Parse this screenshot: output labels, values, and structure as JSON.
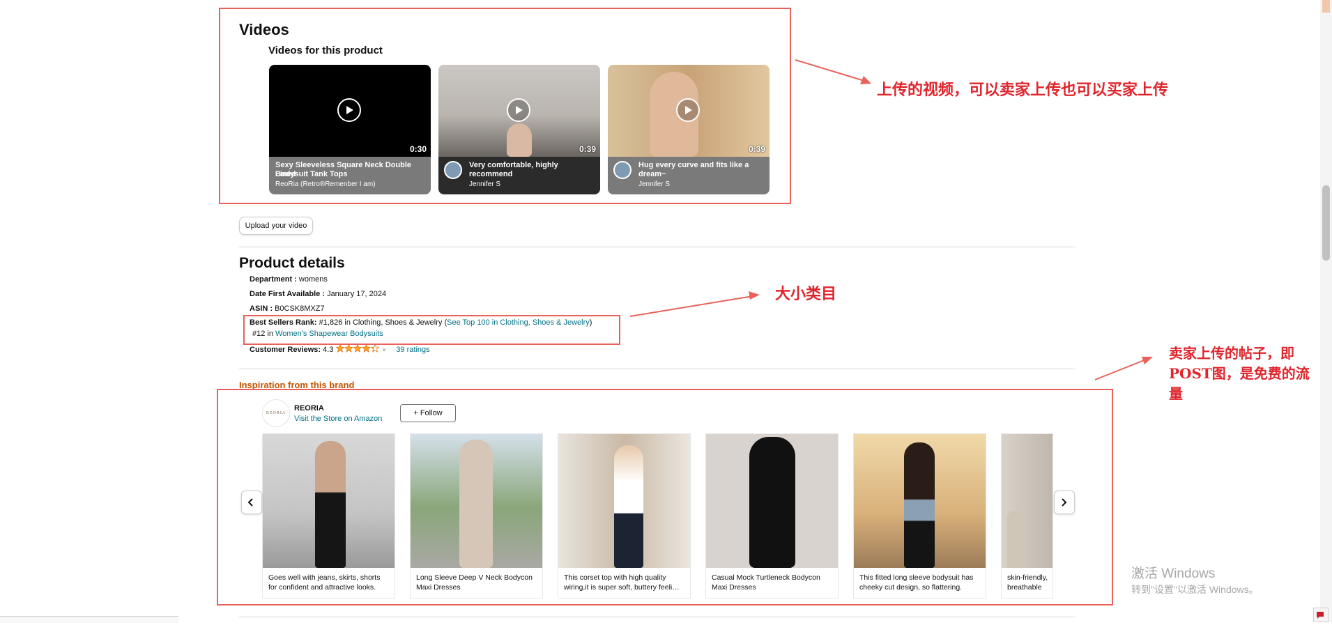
{
  "videos": {
    "section_title": "Videos",
    "subtitle": "Videos for this product",
    "items": [
      {
        "duration": "0:30",
        "title_line1": "Sexy Sleeveless Square Neck Double Lined",
        "title_line2": "Bodysuit Tank Tops",
        "author": "ReoRia (Retro®Remenber I am)"
      },
      {
        "duration": "0:39",
        "title_line1": "Very comfortable, highly",
        "title_line2": "recommend",
        "author": "Jennifer S"
      },
      {
        "duration": "0:39",
        "title_line1": "Hug every curve and fits like a",
        "title_line2": "dream~",
        "author": "Jennifer S"
      }
    ],
    "upload_button": "Upload your video"
  },
  "product_details": {
    "title": "Product details",
    "department_label": "Department",
    "department_value": "womens",
    "date_label": "Date First Available",
    "date_value": "January 17, 2024",
    "asin_label": "ASIN",
    "asin_value": "B0CSK8MXZ7",
    "bsr_label": "Best Sellers Rank:",
    "bsr_value": "#1,826 in Clothing, Shoes & Jewelry",
    "bsr_link": "See Top 100 in Clothing, Shoes & Jewelry",
    "bsr_sub_prefix": "#12 in",
    "bsr_sub_link": "Women's Shapewear Bodysuits",
    "reviews_label": "Customer Reviews:",
    "reviews_value": "4.3",
    "rating": 4.3,
    "ratings_link": "39 ratings"
  },
  "inspiration": {
    "title": "Inspiration from this brand",
    "brand_logo_text": "REORIA",
    "brand_name": "REORIA",
    "store_link": "Visit the Store on Amazon",
    "follow_button": "+ Follow",
    "posts": [
      {
        "caption_line1": "Goes well with jeans, skirts, shorts",
        "caption_line2": "for confident and attractive looks."
      },
      {
        "caption_line1": "Long Sleeve Deep V Neck Bodycon",
        "caption_line2": "Maxi Dresses"
      },
      {
        "caption_line1": "This corset top with high quality",
        "caption_line2": "wiring,it is super soft, buttery feeli…"
      },
      {
        "caption_line1": "Casual Mock Turtleneck Bodycon",
        "caption_line2": "Maxi Dresses"
      },
      {
        "caption_line1": "This fitted long sleeve bodysuit has",
        "caption_line2": "cheeky cut design, so flattering."
      },
      {
        "caption_line1": "skin-friendly,",
        "caption_line2": "breathable"
      }
    ]
  },
  "annotations": {
    "videos_note": "上传的视频，可以卖家上传也可以买家上传",
    "category_note": "大小类目",
    "post_note_line1": "卖家上传的帖子，即",
    "post_note_line2": "POST图，是免费的流",
    "post_note_line3": "量"
  },
  "watermark": {
    "line1": "激活 Windows",
    "line2": "转到\"设置\"以激活 Windows。"
  },
  "colors": {
    "annotation_red": "#e0242c",
    "box_red": "#e8625b",
    "link_teal": "#007185",
    "inspiration_orange": "#c45500",
    "star_orange": "#ffa41c"
  }
}
